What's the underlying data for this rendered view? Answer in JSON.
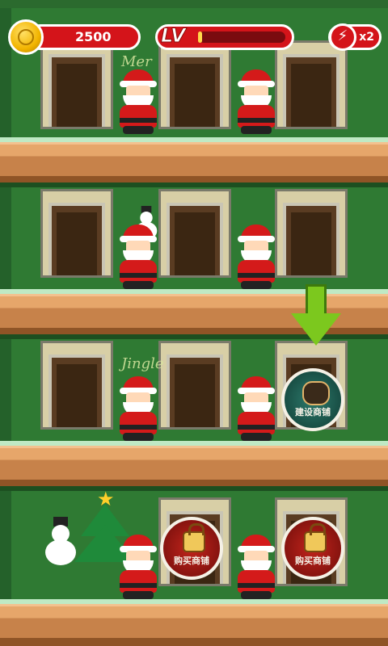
{
  "hud": {
    "coins": "2500",
    "level_label": "LV",
    "level_progress": 0.05,
    "energy_label": "x2",
    "energy_icon": "lightning-bolt-icon",
    "coin_icon": "gold-coin-icon"
  },
  "decor": {
    "text_merry": "Mer",
    "text_jingle": "Jingle"
  },
  "rooms": [
    {
      "floor": 1,
      "slot": 1,
      "state": "idle"
    },
    {
      "floor": 1,
      "slot": 2,
      "state": "idle"
    },
    {
      "floor": 1,
      "slot": 3,
      "state": "idle"
    },
    {
      "floor": 2,
      "slot": 1,
      "state": "idle"
    },
    {
      "floor": 2,
      "slot": 2,
      "state": "idle"
    },
    {
      "floor": 2,
      "slot": 3,
      "state": "idle"
    },
    {
      "floor": 3,
      "slot": 1,
      "state": "idle"
    },
    {
      "floor": 3,
      "slot": 2,
      "state": "idle"
    },
    {
      "floor": 3,
      "slot": 3,
      "state": "unlocked-shop",
      "badge_label": "建设商铺"
    },
    {
      "floor": 4,
      "slot": 2,
      "state": "locked-shop",
      "badge_label": "购买商铺"
    },
    {
      "floor": 4,
      "slot": 3,
      "state": "locked-shop",
      "badge_label": "购买商铺"
    }
  ],
  "colors": {
    "hud_red": "#d4141a",
    "wall_green": "#2f7a33",
    "shelf_wood": "#c7824a",
    "arrow_green": "#7cc81e"
  }
}
